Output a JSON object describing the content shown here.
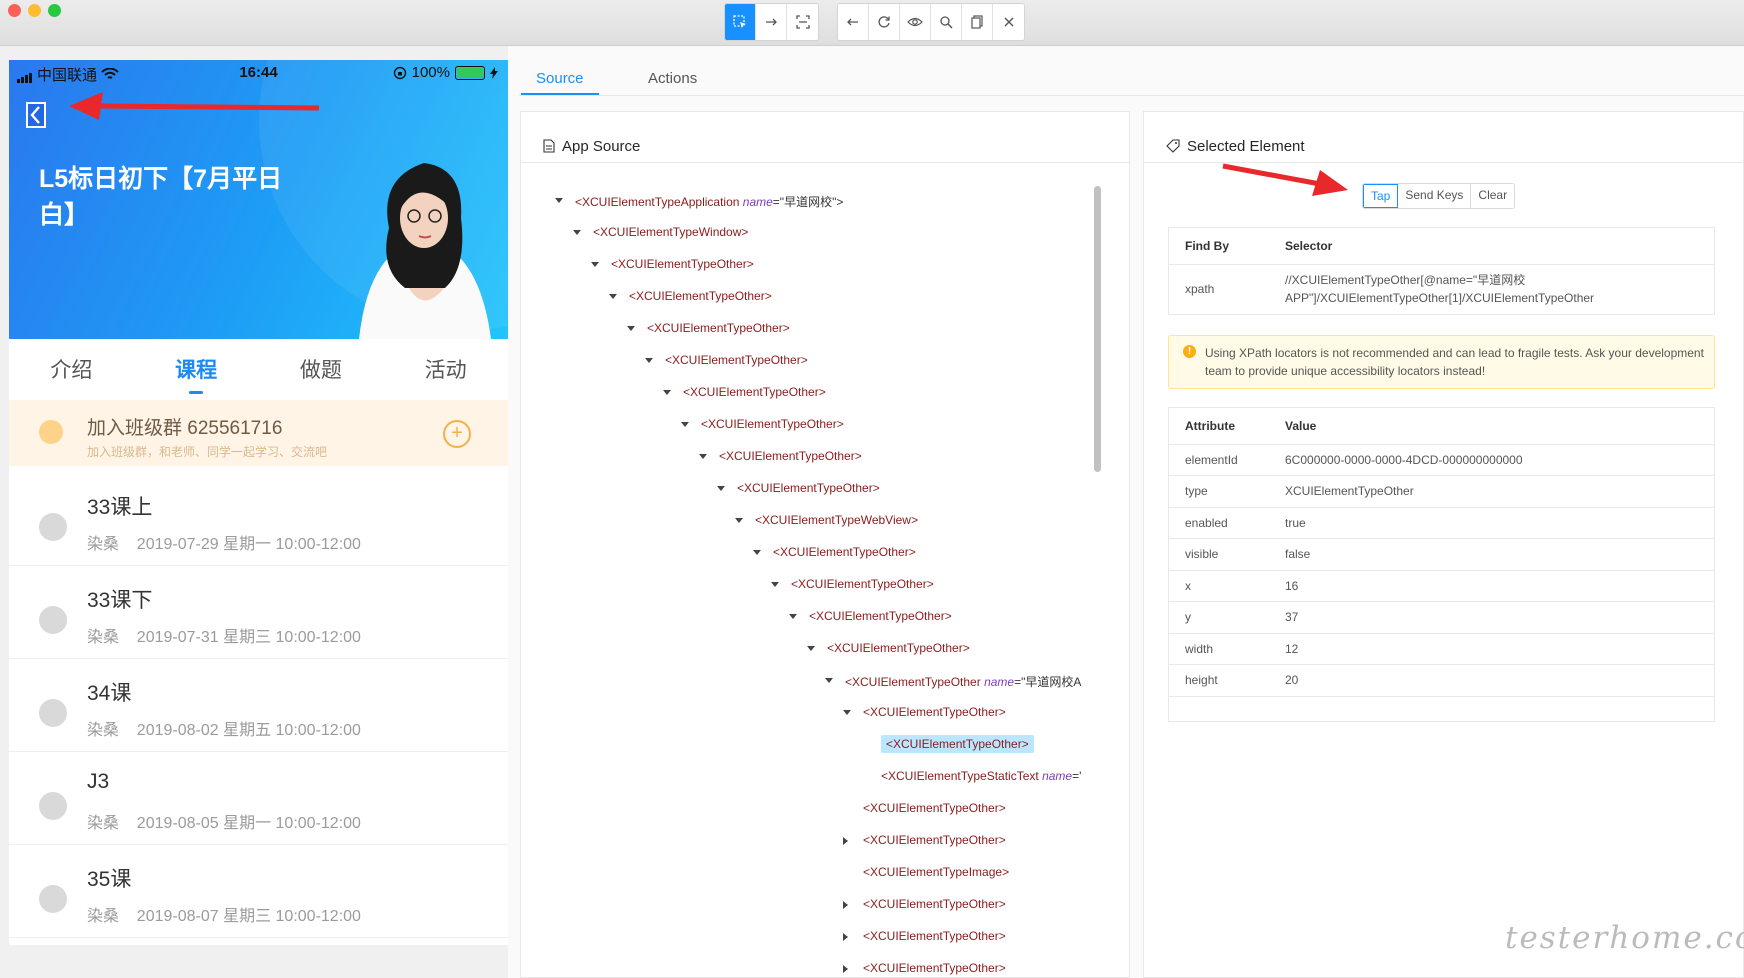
{
  "phone": {
    "status": {
      "carrier": "中国联通",
      "time": "16:44",
      "battery": "100%"
    },
    "course_title": "L5标日初下【7月平日白】",
    "tabs": [
      "介绍",
      "课程",
      "做题",
      "活动"
    ],
    "active_tab": "课程",
    "group": {
      "title": "加入班级群 625561716",
      "subtitle": "加入班级群，和老师、同学一起学习、交流吧"
    },
    "lessons": [
      {
        "title": "33课上",
        "teacher": "染桑",
        "time": "2019-07-29 星期一 10:00-12:00"
      },
      {
        "title": "33课下",
        "teacher": "染桑",
        "time": "2019-07-31 星期三 10:00-12:00"
      },
      {
        "title": "34课",
        "teacher": "染桑",
        "time": "2019-08-02 星期五 10:00-12:00"
      },
      {
        "title": "J3",
        "teacher": "染桑",
        "time": "2019-08-05 星期一 10:00-12:00"
      },
      {
        "title": "35课",
        "teacher": "染桑",
        "time": "2019-08-07 星期三 10:00-12:00"
      }
    ]
  },
  "tabs": {
    "source": "Source",
    "actions": "Actions"
  },
  "app_source": {
    "title": "App Source",
    "nodes": [
      {
        "tag": "<XCUIElementTypeApplication",
        "attr": "name",
        "val": "=\"早道网校\">",
        "end": ""
      },
      {
        "tag": "<XCUIElementTypeWindow>"
      },
      {
        "tag": "<XCUIElementTypeOther>"
      },
      {
        "tag": "<XCUIElementTypeOther>"
      },
      {
        "tag": "<XCUIElementTypeOther>"
      },
      {
        "tag": "<XCUIElementTypeOther>"
      },
      {
        "tag": "<XCUIElementTypeOther>"
      },
      {
        "tag": "<XCUIElementTypeOther>"
      },
      {
        "tag": "<XCUIElementTypeOther>"
      },
      {
        "tag": "<XCUIElementTypeOther>"
      },
      {
        "tag": "<XCUIElementTypeWebView>"
      },
      {
        "tag": "<XCUIElementTypeOther>"
      },
      {
        "tag": "<XCUIElementTypeOther>"
      },
      {
        "tag": "<XCUIElementTypeOther>"
      },
      {
        "tag": "<XCUIElementTypeOther>"
      },
      {
        "tag": "<XCUIElementTypeOther",
        "attr": "name",
        "val": "=\"早道网校A"
      },
      {
        "tag": "<XCUIElementTypeOther>"
      },
      {
        "tag": "<XCUIElementTypeOther>"
      },
      {
        "tag": "<XCUIElementTypeStaticText",
        "attr": "name",
        "val": "='"
      },
      {
        "tag": "<XCUIElementTypeOther>"
      },
      {
        "tag": "<XCUIElementTypeOther>"
      },
      {
        "tag": "<XCUIElementTypeImage>"
      },
      {
        "tag": "<XCUIElementTypeOther>"
      },
      {
        "tag": "<XCUIElementTypeOther>"
      },
      {
        "tag": "<XCUIElementTypeOther>"
      }
    ]
  },
  "selected": {
    "title": "Selected Element",
    "buttons": {
      "tap": "Tap",
      "send_keys": "Send Keys",
      "clear": "Clear"
    },
    "find_by_header": "Find By",
    "selector_header": "Selector",
    "find_by": "xpath",
    "selector_line1": "//XCUIElementTypeOther[@name=\"早道网校",
    "selector_line2": "APP\"]/XCUIElementTypeOther[1]/XCUIElementTypeOther",
    "warning": "Using XPath locators is not recommended and can lead to fragile tests. Ask your development team to provide unique accessibility locators instead!",
    "attr_header": "Attribute",
    "value_header": "Value",
    "attributes": [
      {
        "name": "elementId",
        "value": "6C000000-0000-0000-4DCD-000000000000"
      },
      {
        "name": "type",
        "value": "XCUIElementTypeOther"
      },
      {
        "name": "enabled",
        "value": "true"
      },
      {
        "name": "visible",
        "value": "false"
      },
      {
        "name": "x",
        "value": "16"
      },
      {
        "name": "y",
        "value": "37"
      },
      {
        "name": "width",
        "value": "12"
      },
      {
        "name": "height",
        "value": "20"
      }
    ]
  },
  "watermark": "testerhome.com"
}
